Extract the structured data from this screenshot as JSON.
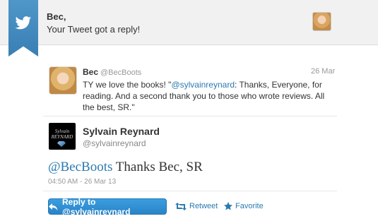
{
  "notification": {
    "name": "Bec,",
    "message": "Your Tweet got a reply!"
  },
  "original_tweet": {
    "name": "Bec",
    "handle": "@BecBoots",
    "date": "26 Mar",
    "text_before": "TY we love the books! \"",
    "mention": "@sylvainreynard",
    "text_after": ": Thanks, Everyone, for reading. And a second thank you to those who wrote reviews. All the best, SR.\""
  },
  "reply": {
    "name": "Sylvain Reynard",
    "handle": "@sylvainreynard",
    "mention": "@BecBoots",
    "text": " Thanks Bec, SR",
    "timestamp": "04:50 AM - 26 Mar 13"
  },
  "actions": {
    "reply_label": "Reply to @sylvainreynard",
    "retweet_label": "Retweet",
    "favorite_label": "Favorite"
  },
  "colors": {
    "accent": "#2a7ab0",
    "button": "#2a83c7",
    "ribbon": "#3a7fb3"
  }
}
